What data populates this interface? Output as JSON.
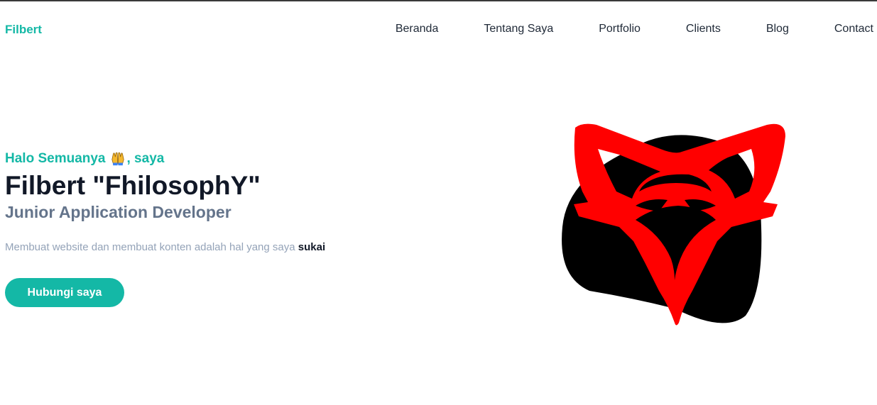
{
  "nav": {
    "brand": "Filbert",
    "links": [
      "Beranda",
      "Tentang Saya",
      "Portfolio",
      "Clients",
      "Blog",
      "Contact"
    ]
  },
  "hero": {
    "greeting_before": "Halo Semuanya",
    "greeting_after": ", saya",
    "greeting_icon": "raised-hands-icon",
    "name": "Filbert \"FhilosophY\"",
    "role": "Junior Application Developer",
    "tagline_prefix": "Membuat website dan membuat konten adalah hal yang saya",
    "tagline_emphasis": "sukai",
    "cta_label": "Hubungi saya",
    "logo_icon": "fox-logo-icon"
  },
  "colors": {
    "accent": "#14b8a6",
    "logo_red": "#ff0000",
    "logo_black": "#000000"
  }
}
